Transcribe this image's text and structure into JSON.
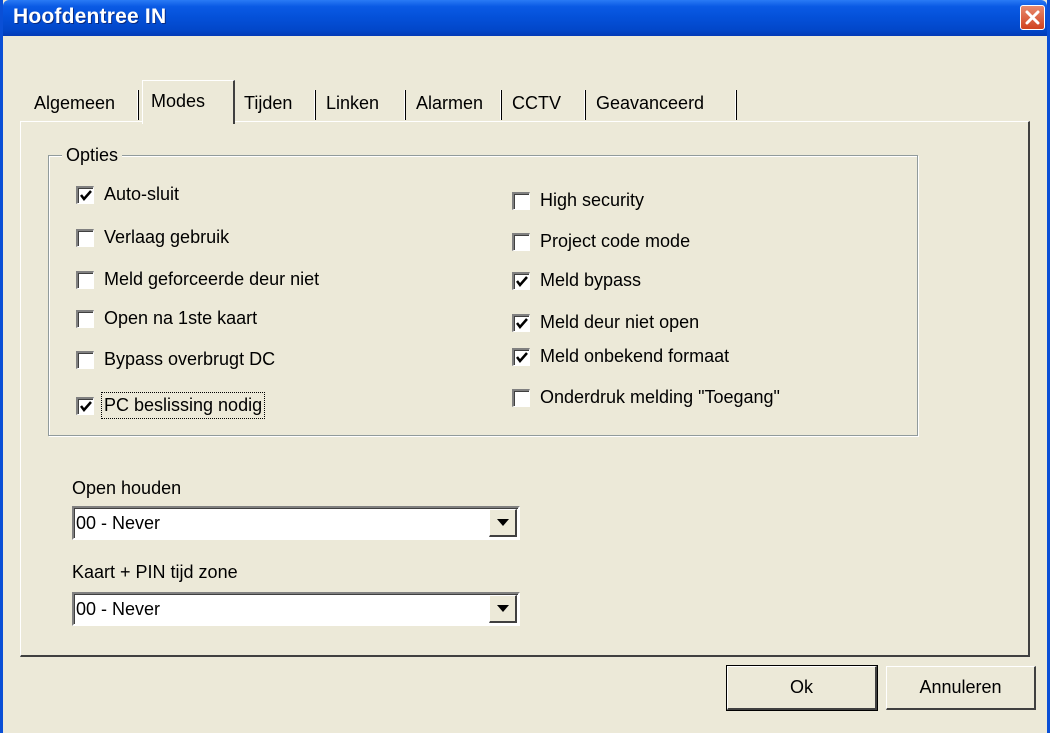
{
  "window": {
    "title": "Hoofdentree IN"
  },
  "tabs": [
    {
      "label": "Algemeen",
      "active": false
    },
    {
      "label": "Modes",
      "active": true
    },
    {
      "label": "Tijden",
      "active": false
    },
    {
      "label": "Linken",
      "active": false
    },
    {
      "label": "Alarmen",
      "active": false
    },
    {
      "label": "CCTV",
      "active": false
    },
    {
      "label": "Geavanceerd",
      "active": false
    }
  ],
  "options": {
    "group_label": "Opties",
    "left": [
      {
        "label": "Auto-sluit",
        "checked": true
      },
      {
        "label": "Verlaag gebruik",
        "checked": false
      },
      {
        "label": "Meld geforceerde deur niet",
        "checked": false
      },
      {
        "label": "Open na 1ste kaart",
        "checked": false
      },
      {
        "label": "Bypass overbrugt DC",
        "checked": false
      },
      {
        "label": "PC beslissing nodig",
        "checked": true,
        "focused": true
      }
    ],
    "right": [
      {
        "label": "High security",
        "checked": false
      },
      {
        "label": "Project code mode",
        "checked": false
      },
      {
        "label": "Meld bypass",
        "checked": true
      },
      {
        "label": "Meld deur niet open",
        "checked": true
      },
      {
        "label": "Meld onbekend formaat",
        "checked": true
      },
      {
        "label": "Onderdruk melding \"Toegang\"",
        "checked": false
      }
    ]
  },
  "open_houden": {
    "label": "Open houden",
    "value": "00 - Never"
  },
  "kaart_pin": {
    "label": "Kaart + PIN tijd zone",
    "value": "00 - Never"
  },
  "buttons": {
    "ok": "Ok",
    "cancel": "Annuleren"
  },
  "icons": {
    "close": "close-icon",
    "check": "checkmark-icon",
    "dropdown": "chevron-down-icon"
  }
}
